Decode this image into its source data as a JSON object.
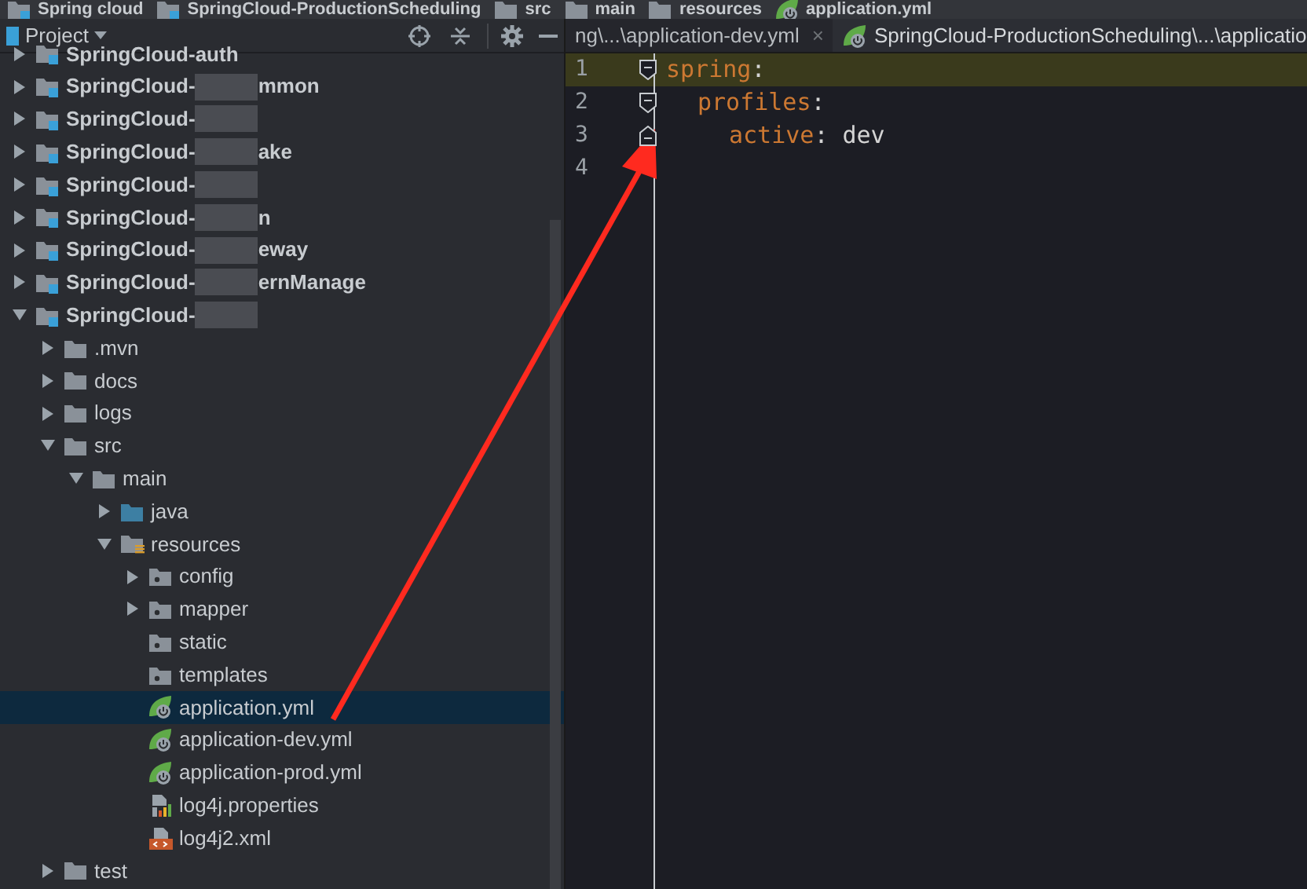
{
  "breadcrumbs": [
    {
      "label": "Spring cloud",
      "kind": "module"
    },
    {
      "label": "SpringCloud-ProductionScheduling",
      "kind": "module"
    },
    {
      "label": "src",
      "kind": "folder"
    },
    {
      "label": "main",
      "kind": "folder"
    },
    {
      "label": "resources",
      "kind": "folder"
    },
    {
      "label": "application.yml",
      "kind": "spring"
    }
  ],
  "project_panel": {
    "title": "Project",
    "tree": [
      {
        "label": "SpringCloud-auth",
        "kind": "module",
        "expanded": false,
        "redacted": false
      },
      {
        "label": "SpringCloud-",
        "label_end": "mmon",
        "kind": "module",
        "expanded": false,
        "redacted": true
      },
      {
        "label": "SpringCloud-",
        "kind": "module",
        "expanded": false,
        "redacted": true
      },
      {
        "label": "SpringCloud-",
        "label_end": "ake",
        "kind": "module",
        "expanded": false,
        "redacted": true
      },
      {
        "label": "SpringCloud-",
        "kind": "module",
        "expanded": false,
        "redacted": true
      },
      {
        "label": "SpringCloud-",
        "label_end": "n",
        "kind": "module",
        "expanded": false,
        "redacted": true
      },
      {
        "label": "SpringCloud-",
        "label_end": "eway",
        "kind": "module",
        "expanded": false,
        "redacted": true
      },
      {
        "label": "SpringCloud-",
        "label_end": "ernManage",
        "kind": "module",
        "expanded": false,
        "redacted": true
      },
      {
        "label": "SpringCloud-",
        "kind": "module",
        "expanded": true,
        "redacted": true,
        "children": [
          {
            "label": ".mvn",
            "kind": "folder",
            "expanded": false
          },
          {
            "label": "docs",
            "kind": "folder",
            "expanded": false
          },
          {
            "label": "logs",
            "kind": "folder",
            "expanded": false
          },
          {
            "label": "src",
            "kind": "folder",
            "expanded": true,
            "children": [
              {
                "label": "main",
                "kind": "folder",
                "expanded": true,
                "children": [
                  {
                    "label": "java",
                    "kind": "source",
                    "expanded": false
                  },
                  {
                    "label": "resources",
                    "kind": "resources",
                    "expanded": true,
                    "children": [
                      {
                        "label": "config",
                        "kind": "package",
                        "expanded": false
                      },
                      {
                        "label": "mapper",
                        "kind": "package",
                        "expanded": false
                      },
                      {
                        "label": "static",
                        "kind": "package"
                      },
                      {
                        "label": "templates",
                        "kind": "package"
                      },
                      {
                        "label": "application.yml",
                        "kind": "spring",
                        "selected": true
                      },
                      {
                        "label": "application-dev.yml",
                        "kind": "spring",
                        "selected": false
                      },
                      {
                        "label": "application-prod.yml",
                        "kind": "spring",
                        "selected": false
                      },
                      {
                        "label": "log4j.properties",
                        "kind": "properties",
                        "selected": false
                      },
                      {
                        "label": "log4j2.xml",
                        "kind": "xml",
                        "selected": false
                      }
                    ]
                  }
                ]
              }
            ]
          },
          {
            "label": "test",
            "kind": "folder",
            "expanded": false
          }
        ]
      }
    ]
  },
  "editor_tabs": [
    {
      "label": "ng\\...\\application-dev.yml",
      "kind": "yaml",
      "selected": false,
      "close": "×"
    },
    {
      "label": "SpringCloud-ProductionScheduling\\...\\applicatio",
      "kind": "spring",
      "selected": true
    }
  ],
  "editor": {
    "lines": [
      {
        "number": "1",
        "current": true,
        "fold_open": true,
        "fold_close": false,
        "tokens": [
          {
            "text": "spring",
            "kind": "key"
          },
          {
            "text": ":",
            "kind": "plain"
          }
        ]
      },
      {
        "number": "2",
        "current": false,
        "fold_open": true,
        "fold_close": false,
        "tokens": [
          {
            "text": "profiles",
            "kind": "key"
          },
          {
            "text": ":",
            "kind": "plain"
          }
        ]
      },
      {
        "number": "3",
        "current": false,
        "fold_open": false,
        "fold_close": true,
        "tokens": [
          {
            "text": "active",
            "kind": "key"
          },
          {
            "text": ": dev",
            "kind": "plain"
          }
        ]
      },
      {
        "number": "4",
        "current": false,
        "fold_open": false,
        "fold_close": false
      }
    ]
  }
}
